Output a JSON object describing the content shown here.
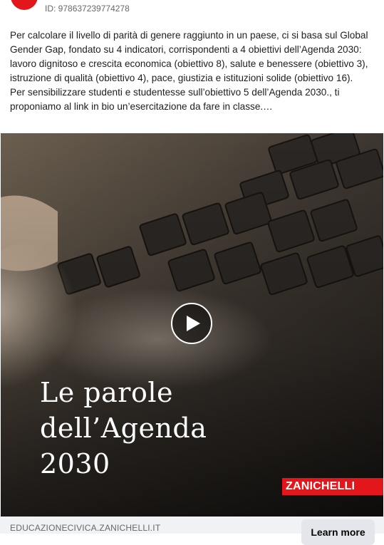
{
  "ad": {
    "id_text": "ID: 978637239774278",
    "body_lines": [
      "Per calcolare il livello di parità di genere raggiunto in un paese, ci si basa sul Global Gender Gap, fondato su 4 indicatori, corrispondenti a 4 obiettivi dell’Agenda 2030: lavoro dignitoso e crescita economica (obiettivo 8), salute e benessere (obiettivo 3), istruzione di qualità (obiettivo 4), pace, giustizia e istituzioni solide (obiettivo 16).",
      "Per sensibilizzare studenti e studentesse sull’obiettivo 5 dell’Agenda 2030., ti proponiamo al link in bio un’esercitazione da fare in classe.…"
    ]
  },
  "video": {
    "title_lines": [
      "Le parole",
      "dell’Agenda",
      "2030"
    ],
    "brand": "ZANICHELLI"
  },
  "footer": {
    "domain": "EDUCAZIONECIVICA.ZANICHELLI.IT",
    "cta": "Learn more"
  },
  "colors": {
    "brand_red": "#e3161b",
    "footer_bg": "#f0f2f5",
    "cta_bg": "#e4e6eb"
  }
}
